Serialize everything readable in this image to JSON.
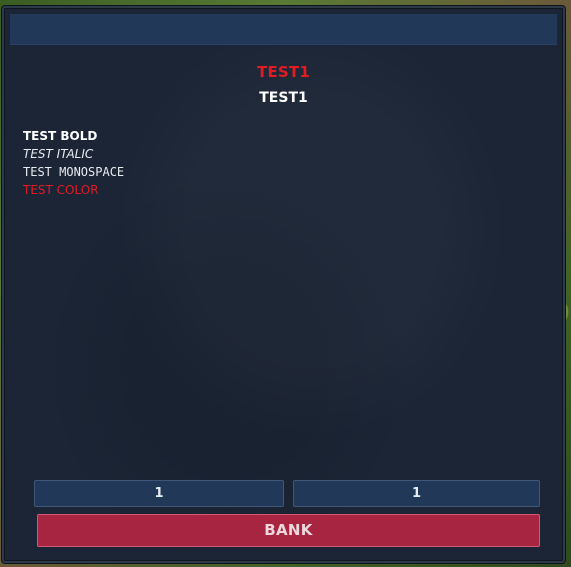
{
  "window": {
    "heading_red": "TEST1",
    "heading_white": "TEST1",
    "lines": {
      "bold": "TEST BOLD",
      "italic": "TEST ITALIC",
      "monospace": "TEST MONOSPACE",
      "colored": "TEST COLOR"
    },
    "buttons": {
      "quantity_left": "1",
      "quantity_right": "1",
      "bank_label": "BANK"
    }
  },
  "colors": {
    "panel_background": "#1b2535",
    "titlebar": "#213859",
    "accent_red_text": "#e31b23",
    "bank_button": "#a82541",
    "quantity_button": "#213859"
  }
}
